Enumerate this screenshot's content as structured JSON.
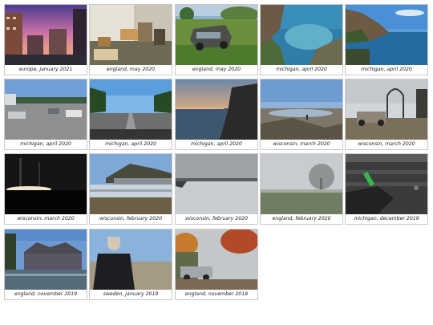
{
  "gallery": {
    "photos": [
      {
        "caption": "europe, january 2021",
        "scene": "sunset-city"
      },
      {
        "caption": "england, may 2020",
        "scene": "room"
      },
      {
        "caption": "england, may 2020",
        "scene": "jeep"
      },
      {
        "caption": "michigan, april 2020",
        "scene": "lake-cliff"
      },
      {
        "caption": "michigan, april 2020",
        "scene": "lake-bluff"
      },
      {
        "caption": "michigan, april 2020",
        "scene": "parking-lot"
      },
      {
        "caption": "michigan, april 2020",
        "scene": "highway"
      },
      {
        "caption": "michigan, april 2020",
        "scene": "lake-dusk"
      },
      {
        "caption": "wisconsin, march 2020",
        "scene": "mudflat"
      },
      {
        "caption": "wisconsin, march 2020",
        "scene": "arch-car"
      },
      {
        "caption": "wisconsin, march 2020",
        "scene": "dark-sunset"
      },
      {
        "caption": "wisconsin, february 2020",
        "scene": "train"
      },
      {
        "caption": "wisconsin, february 2020",
        "scene": "gray-lake"
      },
      {
        "caption": "england, february 2020",
        "scene": "fog-tree"
      },
      {
        "caption": "michigan, december 2019",
        "scene": "lighter"
      },
      {
        "caption": "england, november 2019",
        "scene": "college"
      },
      {
        "caption": "sweden, january 2019",
        "scene": "portrait"
      },
      {
        "caption": "england, november 2018",
        "scene": "autumn-street"
      }
    ]
  }
}
